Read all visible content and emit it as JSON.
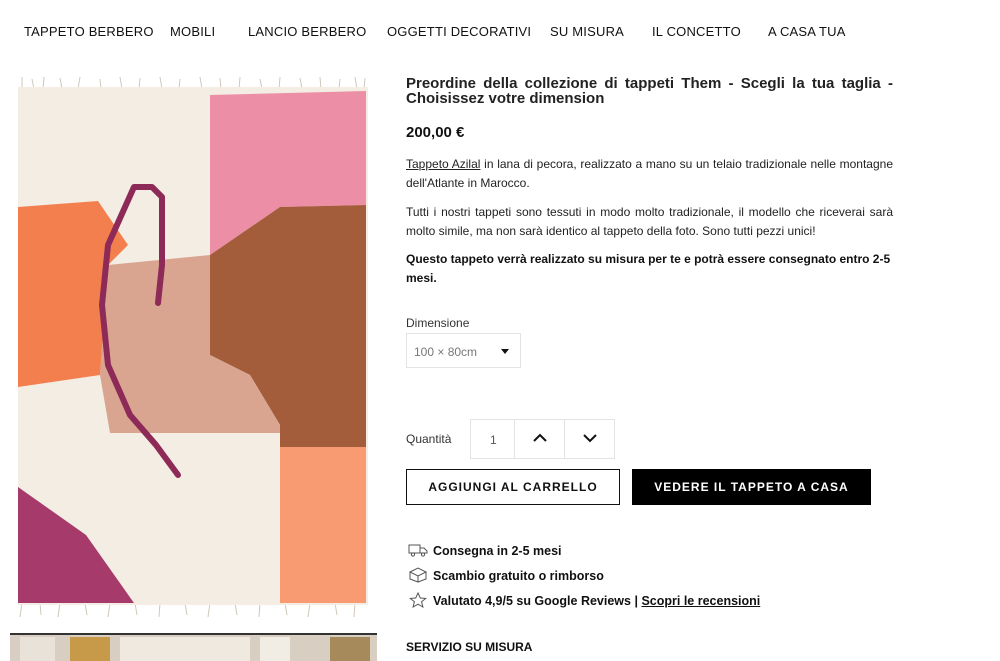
{
  "nav": {
    "items": [
      "TAPPETO BERBERO",
      "MOBILI",
      "LANCIO BERBERO",
      "OGGETTI DECORATIVI",
      "SU MISURA",
      "IL CONCETTO",
      "A CASA TUA"
    ]
  },
  "product": {
    "title": "Preordine della collezione di tappeti Them - Scegli la tua taglia - Choisissez votre dimension",
    "price": "200,00 €",
    "desc1_link": "Tappeto Azilal",
    "desc1_rest": " in lana di pecora, realizzato a mano su un telaio tradizionale nelle montagne dell'Atlante in Marocco.",
    "desc2": "Tutti i nostri tappeti sono tessuti in modo molto tradizionale, il modello che riceverai sarà molto simile, ma non sarà identico al tappeto della foto. Sono tutti pezzi unici!",
    "desc3": "Questo tappeto verrà realizzato su misura per te e potrà essere consegnato entro 2-5 mesi."
  },
  "dimension": {
    "label": "Dimensione",
    "selected": "100 × 80cm"
  },
  "quantity": {
    "label": "Quantità",
    "value": "1"
  },
  "buttons": {
    "add_to_cart": "AGGIUNGI AL CARRELLO",
    "see_at_home": "VEDERE IL TAPPETO A CASA"
  },
  "features": {
    "delivery": "Consegna in 2-5 mesi",
    "exchange": "Scambio gratuito o rimborso",
    "rating_text": "Valutato 4,9/5 su Google Reviews |",
    "reviews_link": "Scopri le recensioni"
  },
  "service_heading": "SERVIZIO SU MISURA",
  "colors": {
    "rug_cream": "#f3ede4",
    "rug_pink": "#ec8ea6",
    "rug_brown": "#a45d3a",
    "rug_orange": "#f47f4e",
    "rug_tan": "#d9a590",
    "rug_magenta": "#a63a6a",
    "rug_line": "#8d2a57"
  }
}
